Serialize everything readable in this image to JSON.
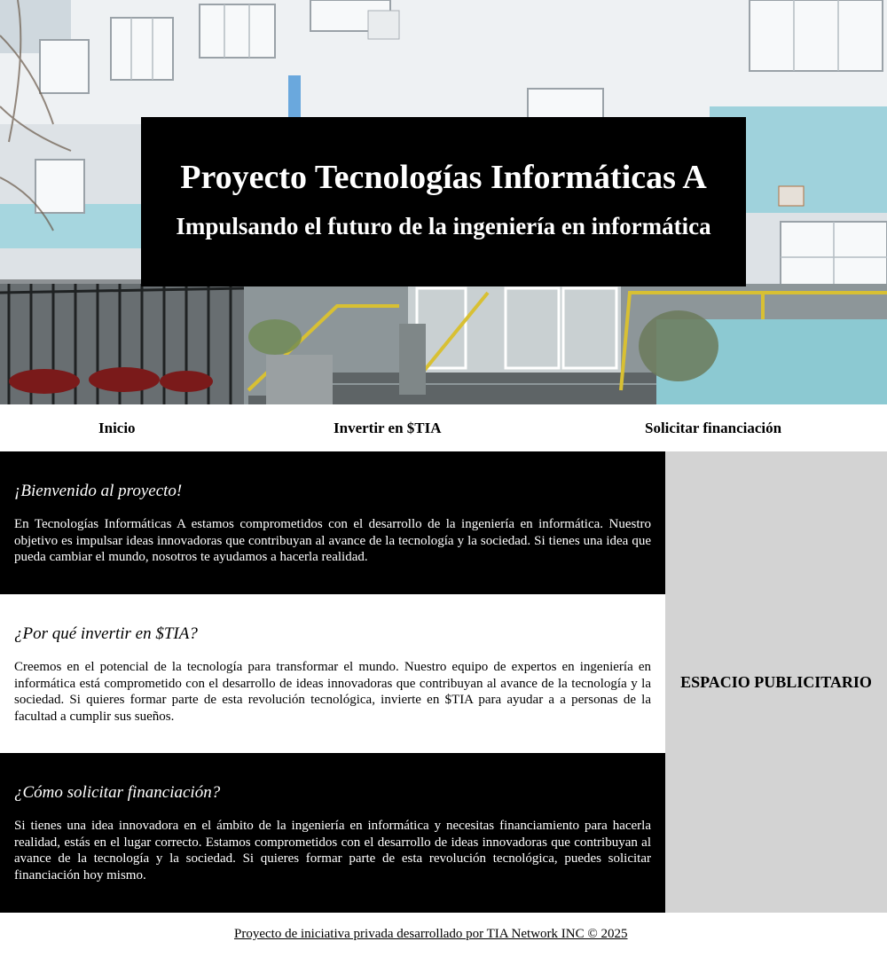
{
  "hero": {
    "title": "Proyecto Tecnologías Informáticas A",
    "subtitle": "Impulsando el futuro de la ingeniería en informática",
    "background_image": "building-photo"
  },
  "nav": {
    "items": [
      {
        "label": "Inicio"
      },
      {
        "label": "Invertir en $TIA"
      },
      {
        "label": "Solicitar financiación"
      }
    ]
  },
  "sections": [
    {
      "heading": "¡Bienvenido al proyecto!",
      "body": "En Tecnologías Informáticas A estamos comprometidos con el desarrollo de la ingeniería en informática. Nuestro objetivo es impulsar ideas innovadoras que contribuyan al avance de la tecnología y la sociedad. Si tienes una idea que pueda cambiar el mundo, nosotros te ayudamos a hacerla realidad."
    },
    {
      "heading": "¿Por qué invertir en $TIA?",
      "body": "Creemos en el potencial de la tecnología para transformar el mundo. Nuestro equipo de expertos en ingeniería en informática está comprometido con el desarrollo de ideas innovadoras que contribuyan al avance de la tecnología y la sociedad. Si quieres formar parte de esta revolución tecnológica, invierte en $TIA para ayudar a a personas de la facultad a cumplir sus sueños."
    },
    {
      "heading": "¿Cómo solicitar financiación?",
      "body": "Si tienes una idea innovadora en el ámbito de la ingeniería en informática y necesitas financiamiento para hacerla realidad, estás en el lugar correcto. Estamos comprometidos con el desarrollo de ideas innovadoras que contribuyan al avance de la tecnología y la sociedad. Si quieres formar parte de esta revolución tecnológica, puedes solicitar financiación hoy mismo."
    }
  ],
  "aside": {
    "label": "ESPACIO PUBLICITARIO"
  },
  "footer": {
    "text": "Proyecto de iniciativa privada desarrollado por TIA Network INC © 2025"
  },
  "colors": {
    "dark_section_bg": "#000000",
    "aside_bg": "#d3d3d3",
    "text_light": "#ffffff",
    "text_dark": "#000000"
  }
}
